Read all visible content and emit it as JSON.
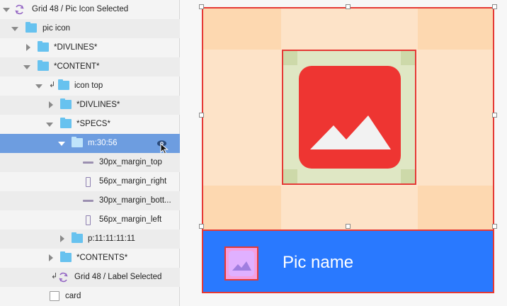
{
  "layers": {
    "rows": [
      {
        "label": "Grid 48 / Pic Icon Selected"
      },
      {
        "label": "pic icon"
      },
      {
        "label": "*DIVLINES*"
      },
      {
        "label": "*CONTENT*"
      },
      {
        "label": "icon top"
      },
      {
        "label": "*DIVLINES*"
      },
      {
        "label": "*SPECS*"
      },
      {
        "label": "m:30:56"
      },
      {
        "label": "30px_margin_top"
      },
      {
        "label": "56px_margin_right"
      },
      {
        "label": "30px_margin_bott..."
      },
      {
        "label": "56px_margin_left"
      },
      {
        "label": "p:11:11:11:11"
      },
      {
        "label": "*CONTENTS*"
      },
      {
        "label": "Grid 48 / Label Selected"
      },
      {
        "label": "card"
      }
    ],
    "selected_row": "m:30:56"
  },
  "canvas": {
    "artboard_title": "Grid 48 / Pic Icon Selected",
    "label": "Pic name"
  },
  "colors": {
    "selection": "#6d9de0",
    "folder": "#67c2ef",
    "guide_red": "#e53935",
    "icon_red": "#ee3532",
    "label_blue": "#2979ff",
    "margin_orange": "#fdd8b0",
    "padding_green": "#dfe7c4"
  },
  "icons": [
    "chevron-icon",
    "folder-icon",
    "symbol-icon",
    "line-icon",
    "eye-icon",
    "cursor-icon",
    "image-icon",
    "checkbox-icon"
  ]
}
